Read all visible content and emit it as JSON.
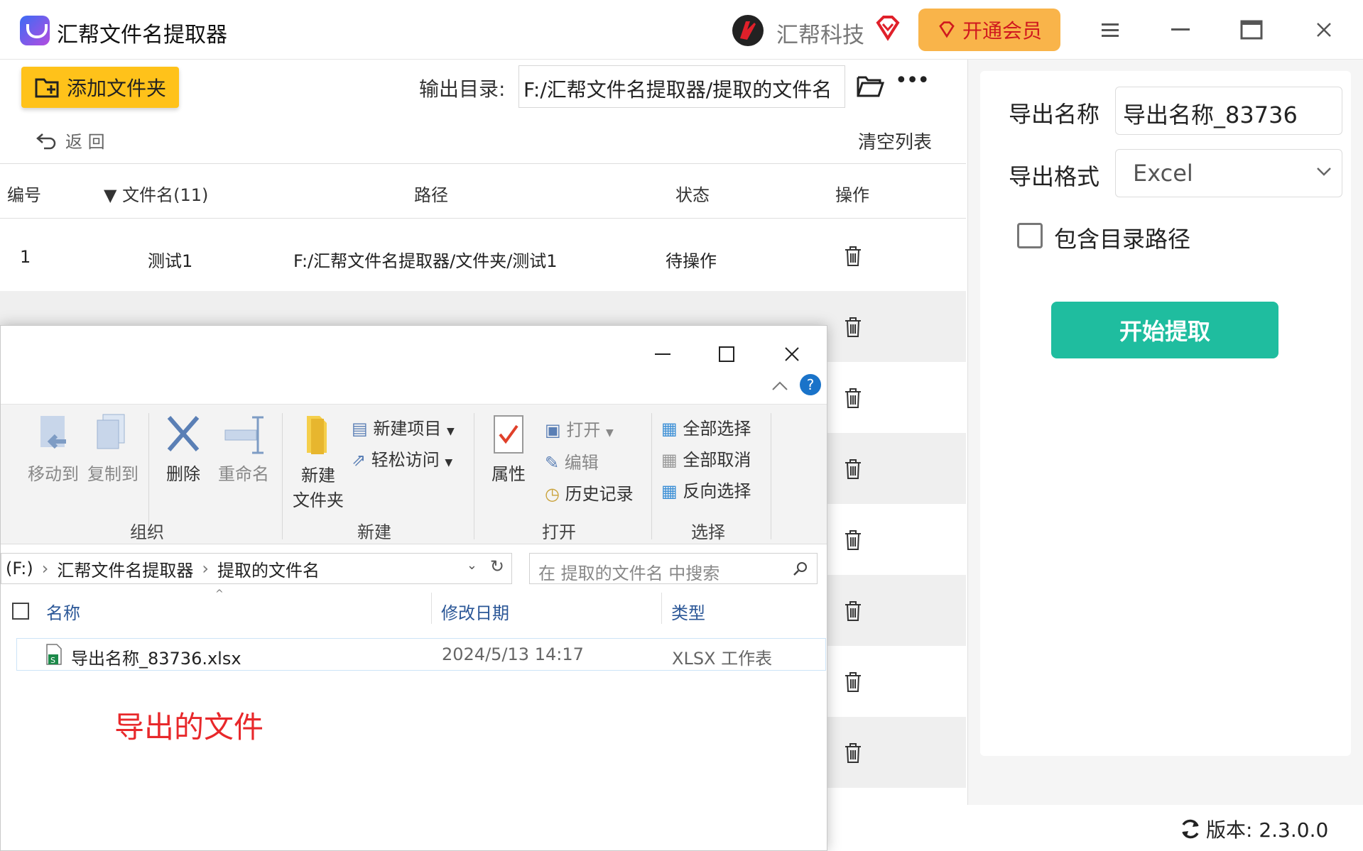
{
  "titlebar": {
    "app_title": "汇帮文件名提取器",
    "brand_name": "汇帮科技",
    "vip_label": "开通会员"
  },
  "toolbar": {
    "add_folder_label": "添加文件夹",
    "output_dir_label": "输出目录:",
    "output_dir_value": "F:/汇帮文件名提取器/提取的文件名",
    "back_label": "返 回",
    "clear_label": "清空列表"
  },
  "table": {
    "headers": {
      "index": "编号",
      "filename": "文件名(11)",
      "path": "路径",
      "status": "状态",
      "action": "操作"
    },
    "rows": [
      {
        "index": "1",
        "name": "测试1",
        "path": "F:/汇帮文件名提取器/文件夹/测试1",
        "status": "待操作"
      }
    ]
  },
  "right_panel": {
    "export_name_label": "导出名称",
    "export_name_value": "导出名称_83736",
    "export_format_label": "导出格式",
    "export_format_value": "Excel",
    "include_path_label": "包含目录路径",
    "include_path_checked": false,
    "start_label": "开始提取"
  },
  "version_label": "版本: 2.3.0.0",
  "explorer": {
    "ribbon": {
      "move_to": "移动到",
      "copy_to": "复制到",
      "delete": "删除",
      "rename": "重命名",
      "new_folder_line1": "新建",
      "new_folder_line2": "文件夹",
      "new_item": "新建项目",
      "easy_access": "轻松访问",
      "properties": "属性",
      "open": "打开",
      "edit": "编辑",
      "history": "历史记录",
      "select_all": "全部选择",
      "select_none": "全部取消",
      "invert_selection": "反向选择",
      "group_organize": "组织",
      "group_new": "新建",
      "group_open": "打开",
      "group_select": "选择"
    },
    "address": {
      "drive": "(F:)",
      "crumb1": "汇帮文件名提取器",
      "crumb2": "提取的文件名"
    },
    "search_placeholder": "在 提取的文件名 中搜索",
    "columns": {
      "name": "名称",
      "modified": "修改日期",
      "type": "类型"
    },
    "files": [
      {
        "name": "导出名称_83736.xlsx",
        "modified": "2024/5/13 14:17",
        "type": "XLSX 工作表"
      }
    ],
    "annotation": "导出的文件"
  },
  "colors": {
    "accent_yellow": "#ffc21a",
    "start_green": "#1fbd9f",
    "vip_orange": "#f9b44a",
    "annotation_red": "#e8282b"
  }
}
